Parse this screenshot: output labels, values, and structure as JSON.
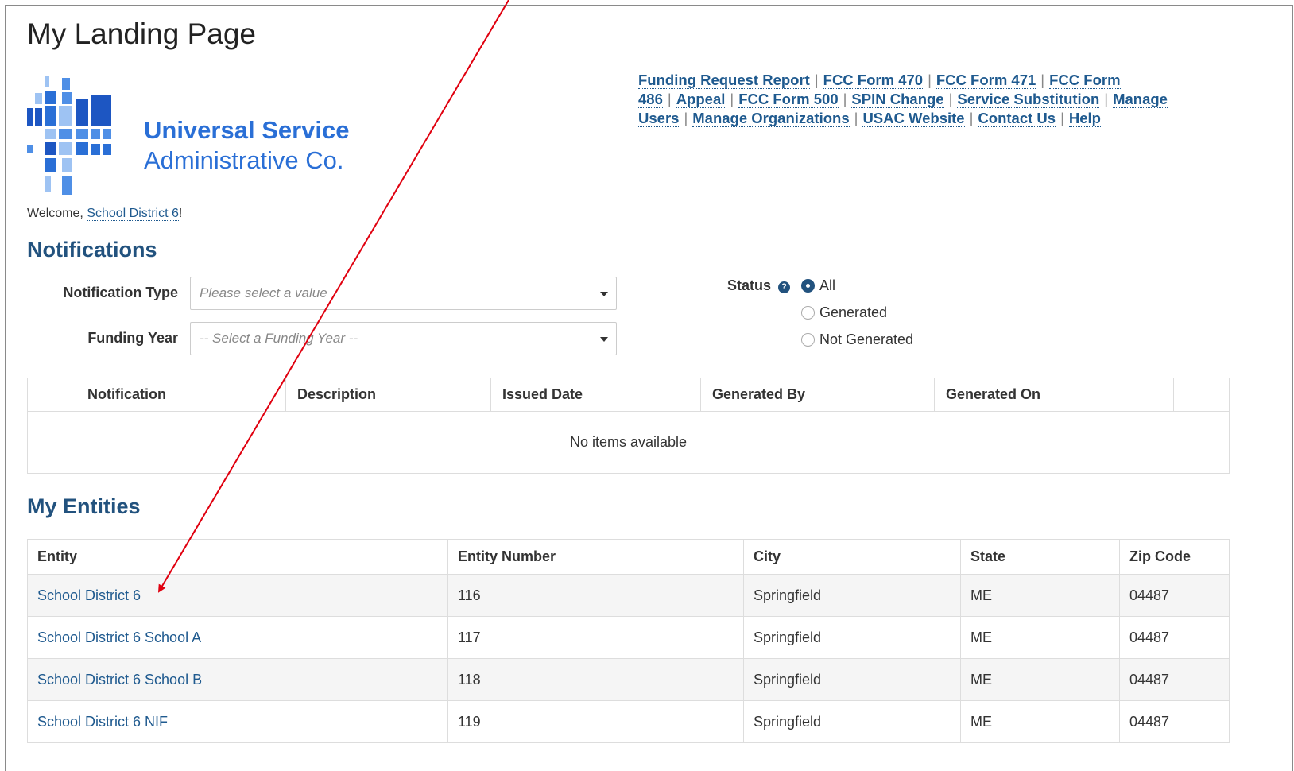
{
  "page": {
    "title": "My Landing Page"
  },
  "logo": {
    "line1": "Universal Service",
    "line2": "Administrative Co."
  },
  "top_links": [
    "Funding Request Report",
    "FCC Form 470",
    "FCC Form 471",
    "FCC Form 486",
    "Appeal",
    "FCC Form 500",
    "SPIN Change",
    "Service Substitution",
    "Manage Users",
    "Manage Organizations",
    "USAC Website",
    "Contact Us",
    "Help"
  ],
  "welcome": {
    "prefix": "Welcome, ",
    "user": "School District 6",
    "suffix": "!"
  },
  "notifications": {
    "title": "Notifications",
    "type_label": "Notification Type",
    "type_placeholder": "Please select a value",
    "year_label": "Funding Year",
    "year_placeholder": "-- Select a Funding Year --",
    "status_label": "Status",
    "status_options": [
      "All",
      "Generated",
      "Not Generated"
    ],
    "status_selected": "All",
    "columns": [
      "Notification",
      "Description",
      "Issued Date",
      "Generated By",
      "Generated On"
    ],
    "empty_text": "No items available"
  },
  "entities": {
    "title": "My Entities",
    "columns": [
      "Entity",
      "Entity Number",
      "City",
      "State",
      "Zip Code"
    ],
    "rows": [
      {
        "entity": "School District 6",
        "number": "116",
        "city": "Springfield",
        "state": "ME",
        "zip": "04487"
      },
      {
        "entity": "School District 6 School A",
        "number": "117",
        "city": "Springfield",
        "state": "ME",
        "zip": "04487"
      },
      {
        "entity": "School District 6 School B",
        "number": "118",
        "city": "Springfield",
        "state": "ME",
        "zip": "04487"
      },
      {
        "entity": "School District 6 NIF",
        "number": "119",
        "city": "Springfield",
        "state": "ME",
        "zip": "04487"
      }
    ]
  },
  "colors": {
    "brand_blue": "#2a6fd6",
    "heading_blue": "#22527e",
    "link_blue": "#1f5a8f",
    "annotation_red": "#e0000f"
  }
}
